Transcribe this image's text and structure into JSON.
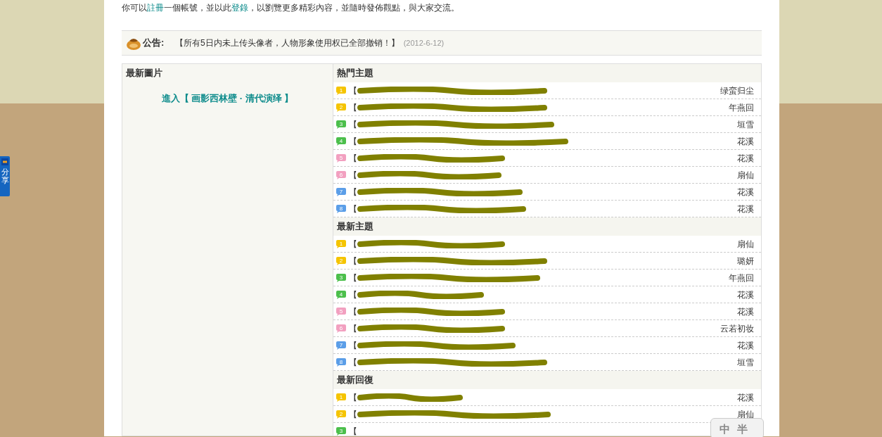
{
  "intro": {
    "before": "你可以",
    "register_link": "註冊",
    "middle": "一個帳號，並以此",
    "login_link": "登錄",
    "after": "，以劉覽更多精彩內容，並隨時發佈觀點，與大家交流。"
  },
  "notice": {
    "label": "公告:",
    "text": "【所有5日内未上传头像者，人物形象使用权已全部撤销！】",
    "date": "(2012-6-12)"
  },
  "pictures": {
    "title": "最新圖片",
    "link": "進入【 画影西林壁 · 清代演绎 】"
  },
  "sections": [
    {
      "title": "熱門主題",
      "rows": [
        {
          "badge": "1",
          "color": "#f5c400",
          "title": "【",
          "author": "绿蛮归尘"
        },
        {
          "badge": "2",
          "color": "#f5c400",
          "title": "【",
          "author": "年燕回"
        },
        {
          "badge": "3",
          "color": "#4cbf4c",
          "title": "【",
          "author": "垣雪"
        },
        {
          "badge": "4",
          "color": "#4cbf4c",
          "title": "【",
          "author": "花溪"
        },
        {
          "badge": "5",
          "color": "#f2a0c0",
          "title": "【",
          "author": "花溪"
        },
        {
          "badge": "6",
          "color": "#f2a0c0",
          "title": "【",
          "author": "扇仙"
        },
        {
          "badge": "7",
          "color": "#5b9ee8",
          "title": "【",
          "author": "花溪"
        },
        {
          "badge": "8",
          "color": "#5b9ee8",
          "title": "【",
          "author": "花溪"
        }
      ]
    },
    {
      "title": "最新主題",
      "rows": [
        {
          "badge": "1",
          "color": "#f5c400",
          "title": "【",
          "author": "扇仙"
        },
        {
          "badge": "2",
          "color": "#f5c400",
          "title": "【",
          "author": "璐妍"
        },
        {
          "badge": "3",
          "color": "#4cbf4c",
          "title": "【",
          "author": "年燕回"
        },
        {
          "badge": "4",
          "color": "#4cbf4c",
          "title": "【",
          "author": "花溪"
        },
        {
          "badge": "5",
          "color": "#f2a0c0",
          "title": "【",
          "author": "花溪"
        },
        {
          "badge": "6",
          "color": "#f2a0c0",
          "title": "【",
          "author": "云若初妆"
        },
        {
          "badge": "7",
          "color": "#5b9ee8",
          "title": "【",
          "author": "花溪"
        },
        {
          "badge": "8",
          "color": "#5b9ee8",
          "title": "【",
          "author": "垣雪"
        }
      ]
    },
    {
      "title": "最新回復",
      "rows": [
        {
          "badge": "1",
          "color": "#f5c400",
          "title": "【",
          "author": "花溪"
        },
        {
          "badge": "2",
          "color": "#f5c400",
          "title": "【",
          "author": "扇仙"
        },
        {
          "badge": "3",
          "color": "#4cbf4c",
          "title": "【"
        }
      ]
    }
  ],
  "share": {
    "text": "分享"
  },
  "ime": {
    "keys": [
      "中",
      "半"
    ]
  }
}
